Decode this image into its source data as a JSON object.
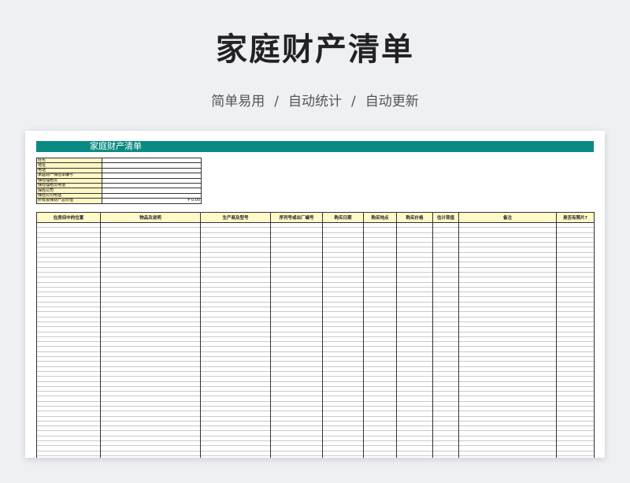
{
  "header": {
    "title": "家庭财产清单",
    "tags": [
      "简单易用",
      "自动统计",
      "自动更新"
    ],
    "separator": "/"
  },
  "sheet": {
    "banner_title": "家庭财产清单",
    "colors": {
      "banner": "#0b8a83",
      "label_fill": "#fff7c4",
      "header_fill": "#fff9c8"
    },
    "info_rows": [
      {
        "label": "姓名",
        "value": ""
      },
      {
        "label": "地址",
        "value": ""
      },
      {
        "label": "电话",
        "value": ""
      },
      {
        "label": "家庭财产保险单编号",
        "value": ""
      },
      {
        "label": "保险理赔员",
        "value": ""
      },
      {
        "label": "保险理赔员电话",
        "value": ""
      },
      {
        "label": "保险公司",
        "value": ""
      },
      {
        "label": "保险公司电话",
        "value": ""
      },
      {
        "label": "所有投保财产总价值",
        "value": "¥ 0.00"
      }
    ],
    "columns": [
      "在房间中的位置",
      "物品及说明",
      "生产商及型号",
      "序列号或出厂编号",
      "购买日期",
      "购买地点",
      "购买价格",
      "估计现值",
      "备注",
      "是否有照片?"
    ]
  }
}
